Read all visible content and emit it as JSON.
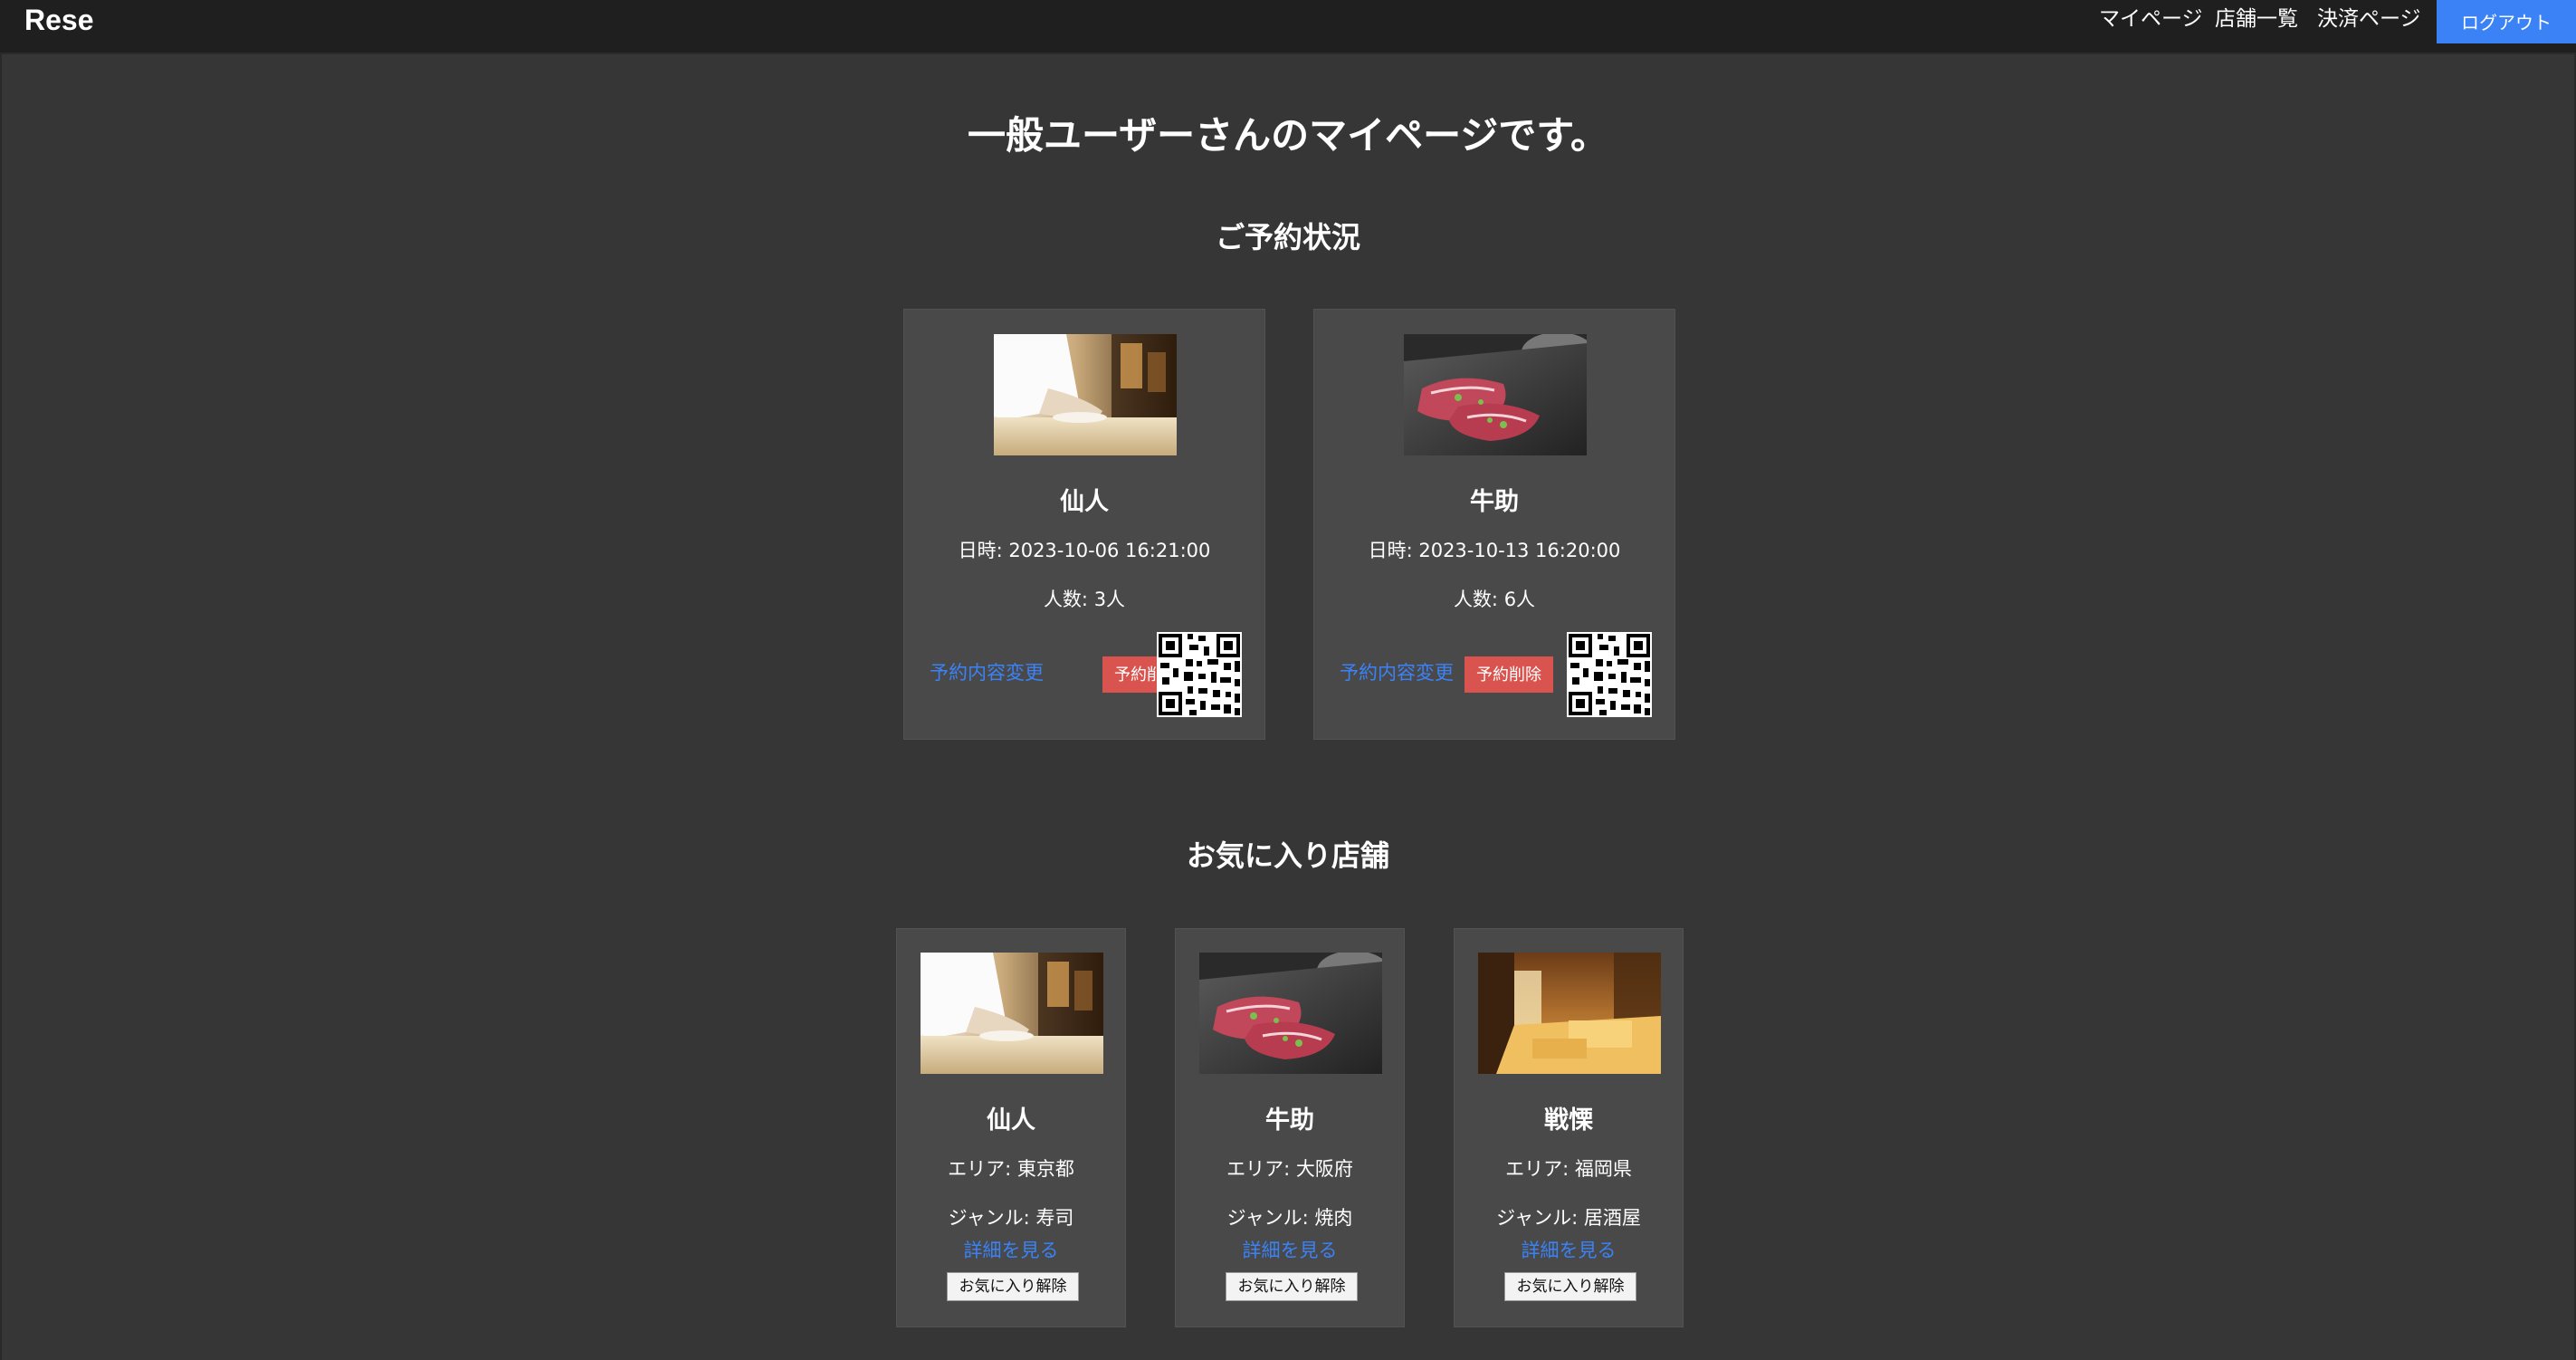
{
  "header": {
    "logo": "Rese",
    "nav": [
      "マイページ",
      "店舗一覧",
      "決済ページ"
    ],
    "logout_label": "ログアウト",
    "logout_color": "#3b82f6"
  },
  "page_title": "一般ユーザーさんのマイページです。",
  "reservations": {
    "title": "ご予約状況",
    "items": [
      {
        "name": "仙人",
        "image": "sushi-chef-photo",
        "datetime": "日時: 2023-10-06 16:21:00",
        "people": "人数: 3人",
        "edit_label": "予約内容変更",
        "delete_label": "予約削除"
      },
      {
        "name": "牛助",
        "image": "yakiniku-beef-photo",
        "datetime": "日時: 2023-10-13 16:20:00",
        "people": "人数: 6人",
        "edit_label": "予約内容変更",
        "delete_label": "予約削除"
      }
    ]
  },
  "favorites": {
    "title": "お気に入り店舗",
    "items": [
      {
        "name": "仙人",
        "image": "sushi-chef-photo",
        "area": "エリア: 東京都",
        "genre": "ジャンル: 寿司",
        "detail_label": "詳細を見る",
        "unfav_label": "お気に入り解除"
      },
      {
        "name": "牛助",
        "image": "yakiniku-beef-photo",
        "area": "エリア: 大阪府",
        "genre": "ジャンル: 焼肉",
        "detail_label": "詳細を見る",
        "unfav_label": "お気に入り解除"
      },
      {
        "name": "戦慄",
        "image": "izakaya-interior-photo",
        "area": "エリア: 福岡県",
        "genre": "ジャンル: 居酒屋",
        "detail_label": "詳細を見る",
        "unfav_label": "お気に入り解除"
      }
    ]
  },
  "colors": {
    "background": "#363636",
    "card": "#494949",
    "link": "#3b82f6",
    "delete": "#d9534f"
  }
}
